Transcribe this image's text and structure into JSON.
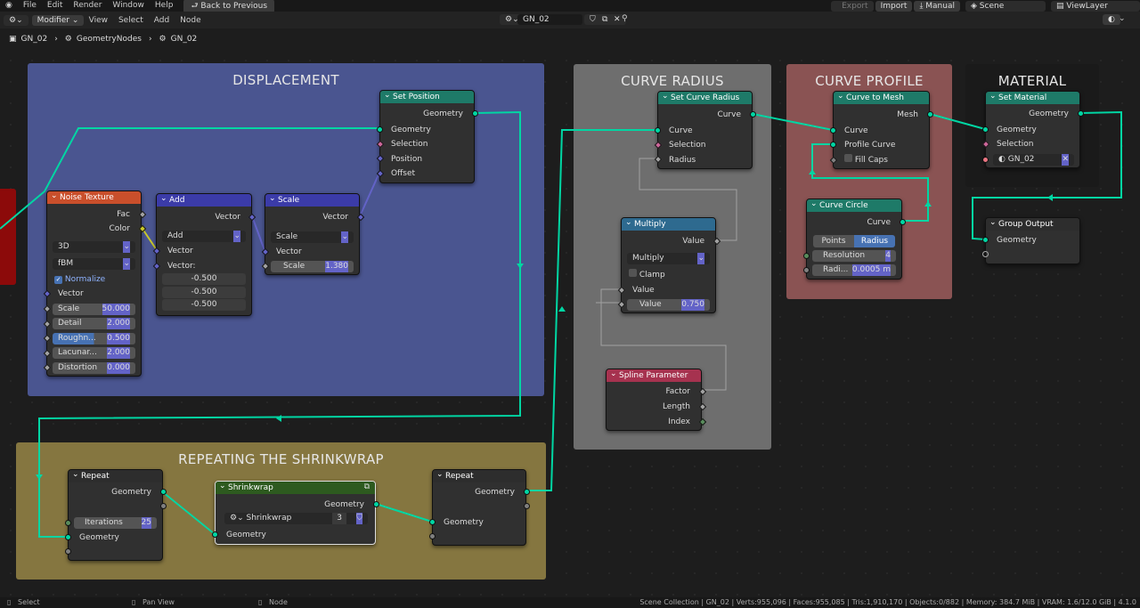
{
  "menu": {
    "items": [
      "File",
      "Edit",
      "Render",
      "Window",
      "Help"
    ],
    "back": "Back to Previous"
  },
  "header_right": {
    "export": "Export",
    "import": "Import",
    "manual": "Manual",
    "scene": "Scene",
    "view_layer": "ViewLayer"
  },
  "toolbar": {
    "mode": "Modifier",
    "items": [
      "View",
      "Select",
      "Add",
      "Node"
    ],
    "tree_name": "GN_02"
  },
  "breadcrumb": [
    "GN_02",
    "GeometryNodes",
    "GN_02"
  ],
  "frames": {
    "displacement": "DISPLACEMENT",
    "curve_radius": "CURVE RADIUS",
    "curve_profile": "CURVE PROFILE",
    "material": "MATERIAL",
    "shrinkwrap": "REPEATING THE SHRINKWRAP"
  },
  "nodes": {
    "set_position": {
      "title": "Set Position",
      "out": "Geometry",
      "inputs": [
        "Geometry",
        "Selection",
        "Position",
        "Offset"
      ]
    },
    "noise": {
      "title": "Noise Texture",
      "outs": [
        "Fac",
        "Color"
      ],
      "dim": "3D",
      "type": "fBM",
      "normalize": "Normalize",
      "vector": "Vector",
      "params": [
        {
          "label": "Scale",
          "value": "50.000"
        },
        {
          "label": "Detail",
          "value": "2.000"
        },
        {
          "label": "Roughn...",
          "value": "0.500"
        },
        {
          "label": "Lacunar...",
          "value": "2.000"
        },
        {
          "label": "Distortion",
          "value": "0.000"
        }
      ]
    },
    "add": {
      "title": "Add",
      "out": "Vector",
      "op": "Add",
      "in1": "Vector",
      "in2": "Vector:",
      "vals": [
        "-0.500",
        "-0.500",
        "-0.500"
      ]
    },
    "scale": {
      "title": "Scale",
      "out": "Vector",
      "op": "Scale",
      "in1": "Vector",
      "scale_label": "Scale",
      "scale_value": "1.380"
    },
    "set_curve_radius": {
      "title": "Set Curve Radius",
      "out": "Curve",
      "inputs": [
        "Curve",
        "Selection",
        "Radius"
      ]
    },
    "multiply": {
      "title": "Multiply",
      "out": "Value",
      "op": "Multiply",
      "clamp": "Clamp",
      "in1": "Value",
      "in2_label": "Value",
      "in2_value": "0.750"
    },
    "spline_param": {
      "title": "Spline Parameter",
      "outs": [
        "Factor",
        "Length",
        "Index"
      ]
    },
    "curve_to_mesh": {
      "title": "Curve to Mesh",
      "out": "Mesh",
      "inputs": [
        "Curve",
        "Profile Curve"
      ],
      "fill_caps": "Fill Caps"
    },
    "curve_circle": {
      "title": "Curve Circle",
      "out": "Curve",
      "mode_a": "Points",
      "mode_b": "Radius",
      "res_label": "Resolution",
      "res_value": "4",
      "rad_label": "Radi...",
      "rad_value": "0.0005 m"
    },
    "set_material": {
      "title": "Set Material",
      "out": "Geometry",
      "inputs": [
        "Geometry",
        "Selection"
      ],
      "material": "GN_02"
    },
    "group_output": {
      "title": "Group Output",
      "input": "Geometry"
    },
    "repeat_in": {
      "title": "Repeat",
      "out": "Geometry",
      "iter_label": "Iterations",
      "iter_value": "25",
      "input": "Geometry"
    },
    "shrinkwrap": {
      "title": "Shrinkwrap",
      "out": "Geometry",
      "group": "Shrinkwrap",
      "users": "3",
      "input": "Geometry"
    },
    "repeat_out": {
      "title": "Repeat",
      "out": "Geometry",
      "input": "Geometry"
    }
  },
  "status": {
    "select": "Select",
    "pan": "Pan View",
    "node": "Node",
    "stats": "Scene Collection | GN_02 | Verts:955,096 | Faces:955,085 | Tris:1,910,170 | Objects:0/882 | Memory: 384.7 MiB | VRAM: 1.6/12.0 GiB | 4.1.0"
  },
  "colors": {
    "geometry_wire": "#00d6a3",
    "geo_header": "#1e7a68",
    "input_header": "#c94f2b",
    "vector_header": "#3b3ba8",
    "func_header": "#2e6a8f",
    "spline_header": "#a6324f",
    "group_header": "#2d2d2d",
    "shrink_header": "#2d5a1f"
  }
}
